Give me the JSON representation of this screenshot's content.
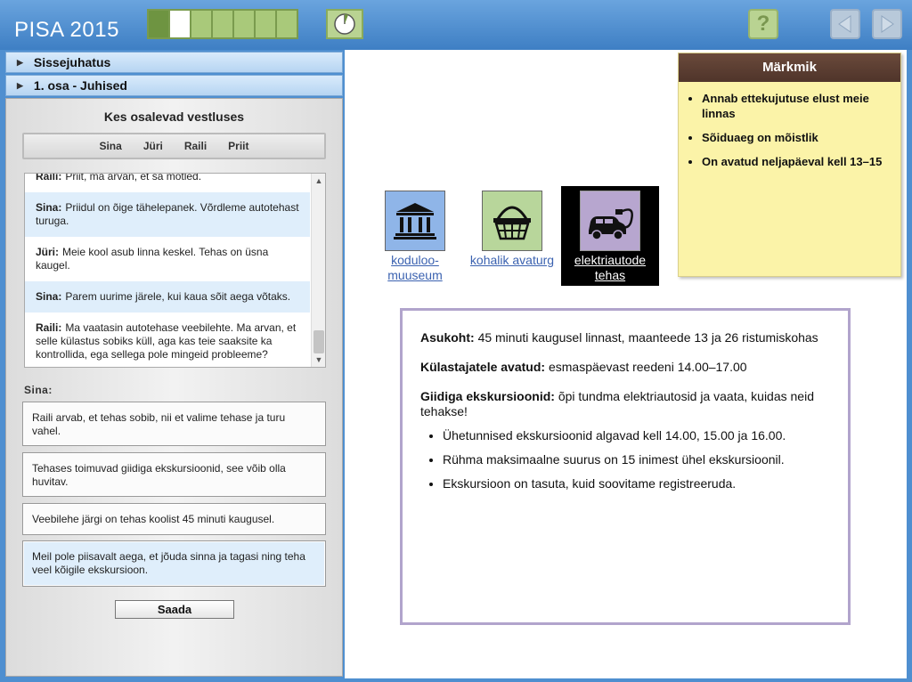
{
  "header": {
    "title": "PISA 2015",
    "progress": {
      "total": 7,
      "done": 1,
      "current": 2
    },
    "help_label": "?"
  },
  "accordion": [
    {
      "label": "Sissejuhatus"
    },
    {
      "label": "1. osa - Juhised"
    }
  ],
  "conversation": {
    "heading": "Kes osalevad vestluses",
    "participants": [
      "Sina",
      "Jüri",
      "Raili",
      "Priit"
    ],
    "messages": [
      {
        "speaker": "Raili:",
        "text": "Priit, ma arvan, et sa mõtled.",
        "highlight": false
      },
      {
        "speaker": "Sina:",
        "text": "Priidul on õige tähelepanek. Võrdleme autotehast turuga.",
        "highlight": true
      },
      {
        "speaker": "Jüri:",
        "text": "Meie kool asub linna keskel. Tehas on üsna kaugel.",
        "highlight": false
      },
      {
        "speaker": "Sina:",
        "text": "Parem uurime järele, kui kaua sõit aega võtaks.",
        "highlight": true
      },
      {
        "speaker": "Raili:",
        "text": "Ma vaatasin autotehase veebilehte. Ma arvan, et selle külastus sobiks küll, aga kas teie saaksite ka kontrollida, ega sellega pole mingeid probleeme?",
        "highlight": false
      }
    ]
  },
  "response": {
    "label": "Sina:",
    "options": [
      "Raili arvab, et tehas sobib, nii et valime tehase ja turu vahel.",
      "Tehases toimuvad giidiga ekskursioonid, see võib olla huvitav.",
      "Veebilehe järgi on tehas koolist 45 minuti kaugusel.",
      "Meil pole piisavalt aega, et jõuda sinna ja tagasi ning teha veel kõigile ekskursioon."
    ],
    "selected_index": 3,
    "send_label": "Saada"
  },
  "notes": {
    "title": "Märkmik",
    "items": [
      "Annab ettekujutuse elust meie linnas",
      "Sõiduaeg on mõistlik",
      "On avatud neljapäeval kell 13–15"
    ]
  },
  "places": [
    {
      "label": "koduloo-muuseum",
      "icon": "museum-icon"
    },
    {
      "label": "kohalik avaturg",
      "icon": "basket-icon"
    },
    {
      "label": "elektriautode tehas",
      "icon": "electric-car-icon",
      "selected": true
    }
  ],
  "info": {
    "location_label": "Asukoht:",
    "location_text": "45 minuti kaugusel linnast, maanteede 13 ja 26 ristumiskohas",
    "open_label": "Külastajatele avatud:",
    "open_text": "esmaspäevast reedeni 14.00–17.00",
    "tours_label": "Giidiga ekskursioonid:",
    "tours_text": "õpi tundma elektriautosid ja vaata, kuidas neid tehakse!",
    "bullets": [
      "Ühetunnised ekskursioonid algavad kell 14.00, 15.00 ja 16.00.",
      "Rühma maksimaalne suurus on 15 inimest ühel ekskursioonil.",
      "Ekskursioon on tasuta, kuid soovitame registreeruda."
    ]
  },
  "colors": {
    "header_blue": "#4f8fd0",
    "progress_green": "#a9c97a",
    "notes_yellow": "#fbf3a8",
    "notes_header": "#5c3f33",
    "selected_blue": "#dfeefb"
  }
}
